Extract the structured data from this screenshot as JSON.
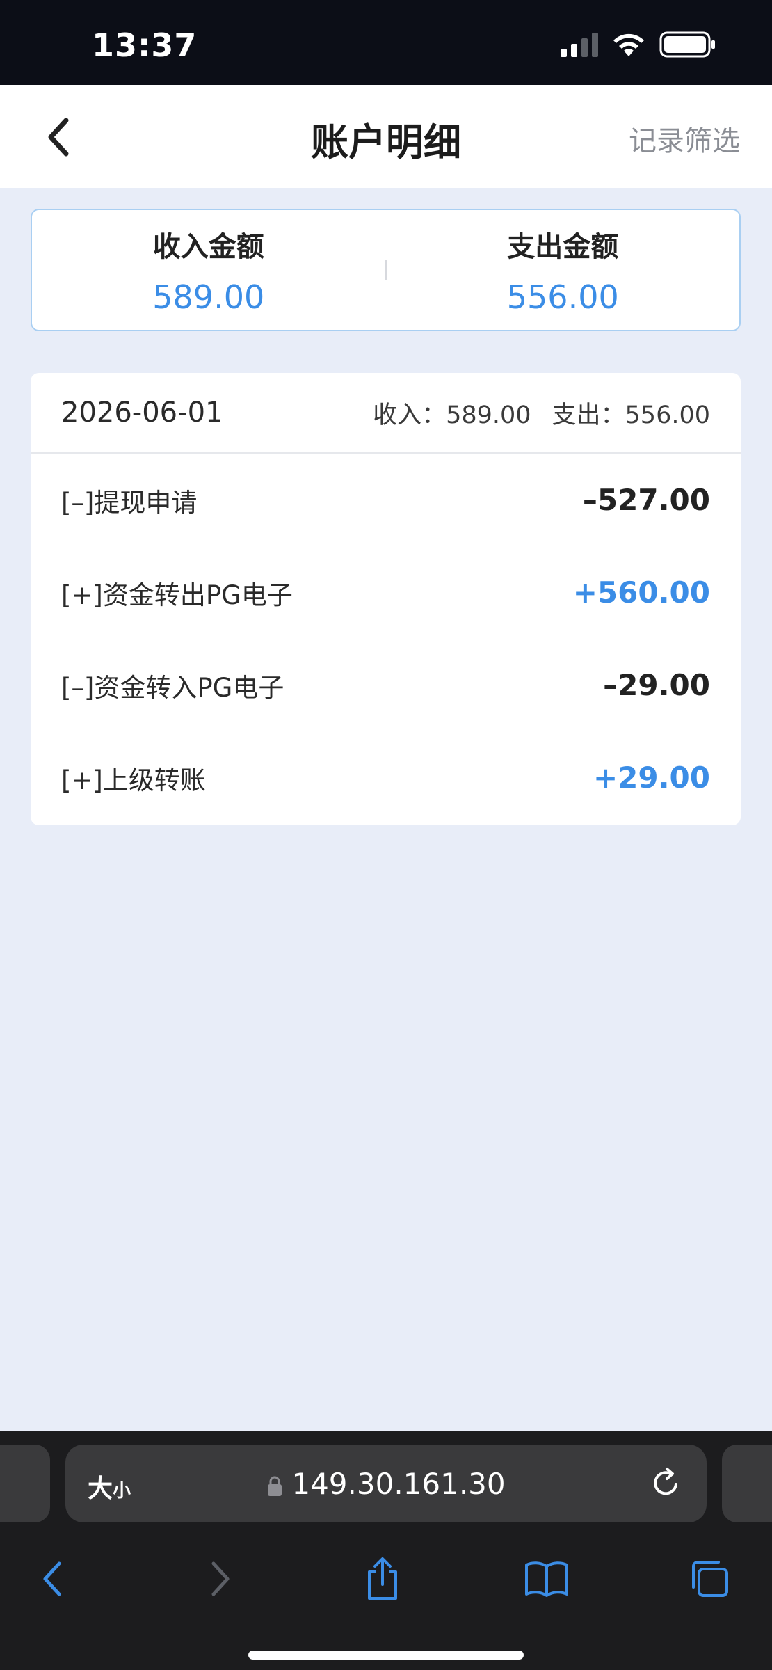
{
  "status_bar": {
    "time": "13:37"
  },
  "header": {
    "title": "账户明细",
    "filter_label": "记录筛选"
  },
  "summary": {
    "income_label": "收入金额",
    "income_value": "589.00",
    "expense_label": "支出金额",
    "expense_value": "556.00"
  },
  "records": {
    "date": "2026-06-01",
    "income_text": "收入：589.00",
    "expense_text": "支出：556.00",
    "items": [
      {
        "name": "[–]提现申请",
        "amount": "–527.00"
      },
      {
        "name": "[+]资金转出PG电子",
        "amount": "+560.00"
      },
      {
        "name": "[–]资金转入PG电子",
        "amount": "–29.00"
      },
      {
        "name": "[+]上级转账",
        "amount": "+29.00"
      }
    ]
  },
  "browser": {
    "reader_big": "大",
    "reader_small": "小",
    "url": "149.30.161.30"
  },
  "colors": {
    "accent": "#3b8de6",
    "background": "#e8edf8",
    "browser": "#1c1c1e"
  }
}
